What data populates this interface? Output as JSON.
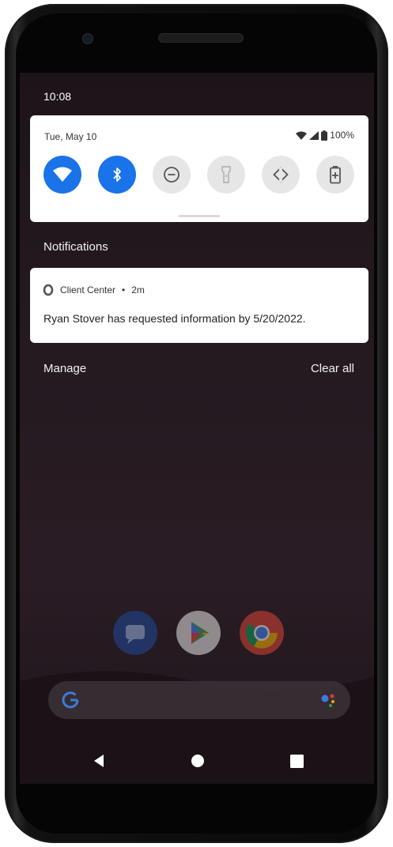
{
  "status_bar": {
    "time": "10:08"
  },
  "quick_settings": {
    "date": "Tue, May 10",
    "battery_percent": "100%",
    "tiles": [
      {
        "name": "wifi-icon",
        "state": "on"
      },
      {
        "name": "bluetooth-icon",
        "state": "on"
      },
      {
        "name": "do-not-disturb-icon",
        "state": "off"
      },
      {
        "name": "flashlight-icon",
        "state": "off"
      },
      {
        "name": "auto-rotate-icon",
        "state": "off"
      },
      {
        "name": "battery-saver-icon",
        "state": "off"
      }
    ],
    "accent_color": "#1a73e8"
  },
  "notifications": {
    "heading": "Notifications",
    "items": [
      {
        "app": "Client Center",
        "separator": "•",
        "time": "2m",
        "text": "Ryan Stover has requested information by 5/20/2022."
      }
    ],
    "manage_label": "Manage",
    "clear_all_label": "Clear all"
  },
  "home": {
    "dock_icons": [
      "messages-icon",
      "play-store-icon",
      "chrome-icon"
    ],
    "search_icons": [
      "google-g-icon",
      "assistant-icon"
    ]
  },
  "navigation": {
    "buttons": [
      "back-icon",
      "home-icon",
      "recents-icon"
    ]
  }
}
